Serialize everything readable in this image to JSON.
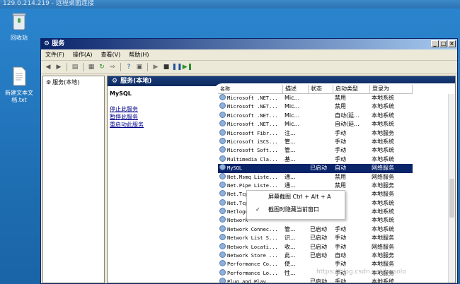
{
  "rdp_title": "129.0.214.219 - 远程桌面连接",
  "desktop": {
    "recycle_bin": "回收站",
    "new_text_file": "新建文本文档.txt"
  },
  "window": {
    "title": "服务",
    "menu": [
      "文件(F)",
      "操作(A)",
      "查看(V)",
      "帮助(H)"
    ],
    "controls": {
      "min": "_",
      "max": "□",
      "close": "×"
    }
  },
  "tree": {
    "item": "服务(本地)"
  },
  "panel": {
    "header": "服务(本地)",
    "selected_service": "MySQL",
    "actions": [
      "停止此服务",
      "暂停此服务",
      "重启动此服务"
    ]
  },
  "table": {
    "columns": [
      "名称",
      "描述",
      "状态",
      "启动类型",
      "登录为"
    ],
    "rows": [
      [
        "Microsoft .NET...",
        "Mic...",
        "",
        "禁用",
        "本地系统"
      ],
      [
        "Microsoft .NET...",
        "Mic...",
        "",
        "禁用",
        "本地系统"
      ],
      [
        "Microsoft .NET...",
        "Mic...",
        "",
        "自动(延...",
        "本地系统"
      ],
      [
        "Microsoft .NET...",
        "Mic...",
        "",
        "自动(延...",
        "本地系统"
      ],
      [
        "Microsoft Fibr...",
        "注...",
        "",
        "手动",
        "本地服务"
      ],
      [
        "Microsoft iSCS...",
        "管...",
        "",
        "手动",
        "本地系统"
      ],
      [
        "Microsoft Soft...",
        "管...",
        "",
        "手动",
        "本地系统"
      ],
      [
        "Multimedia Cla...",
        "基...",
        "",
        "手动",
        "本地系统"
      ],
      [
        "MySQL",
        "",
        "已启动",
        "自动",
        "网络服务"
      ],
      [
        "Net.Msmq Liste...",
        "通...",
        "",
        "禁用",
        "网络服务"
      ],
      [
        "Net.Pipe Liste...",
        "通...",
        "",
        "禁用",
        "本地服务"
      ],
      [
        "Net.Tcp",
        "",
        "",
        "",
        "本地服务"
      ],
      [
        "Net.Tcp",
        "",
        "",
        "",
        "本地系统"
      ],
      [
        "Netlogo",
        "",
        "",
        "",
        "本地系统"
      ],
      [
        "Network",
        "",
        "",
        "",
        "本地系统"
      ],
      [
        "Network Connec...",
        "管...",
        "已启动",
        "手动",
        "本地系统"
      ],
      [
        "Network List S...",
        "识...",
        "已启动",
        "手动",
        "本地服务"
      ],
      [
        "Network Locati...",
        "收...",
        "已启动",
        "手动",
        "网络服务"
      ],
      [
        "Network Store ...",
        "此...",
        "已启动",
        "自动",
        "本地服务"
      ],
      [
        "Performance Co...",
        "使...",
        "",
        "手动",
        "本地服务"
      ],
      [
        "Performance Lo...",
        "性...",
        "",
        "手动",
        "本地服务"
      ],
      [
        "Plug and Play",
        "",
        "已启动",
        "手动",
        "本地系统"
      ]
    ],
    "selected_index": 8
  },
  "context_menu": [
    {
      "label": "屏幕截图 Ctrl + Alt + A",
      "checked": false
    },
    {
      "label": "截图时隐藏当前窗口",
      "checked": true
    }
  ],
  "watermark": "https://blog.csdn.net/ly_solo"
}
